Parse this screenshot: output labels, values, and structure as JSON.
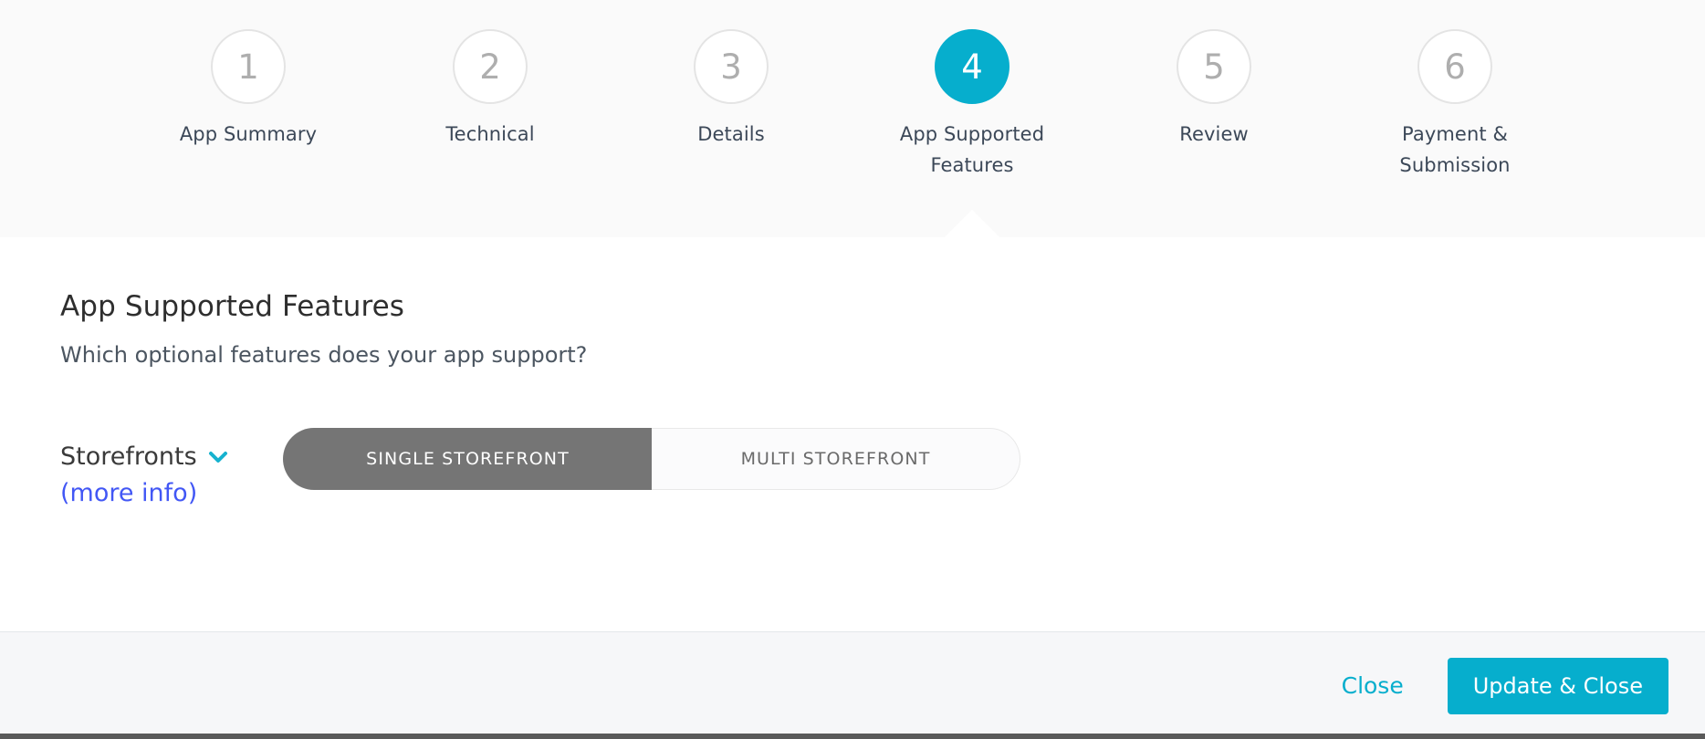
{
  "wizard": {
    "active_step": 4,
    "accent_color": "#06aecd",
    "steps": [
      {
        "number": "1",
        "label": "App Summary"
      },
      {
        "number": "2",
        "label": "Technical"
      },
      {
        "number": "3",
        "label": "Details"
      },
      {
        "number": "4",
        "label": "App Supported Features"
      },
      {
        "number": "5",
        "label": "Review"
      },
      {
        "number": "6",
        "label": "Payment & Submission"
      }
    ]
  },
  "main": {
    "title": "App Supported Features",
    "subtitle": "Which optional features does your app support?",
    "features": [
      {
        "label": "Storefronts",
        "expander_icon": "chevron-down-icon",
        "more_info_label": "(more info)",
        "options": [
          {
            "label": "SINGLE STOREFRONT",
            "selected": true
          },
          {
            "label": "MULTI STOREFRONT",
            "selected": false
          }
        ]
      }
    ]
  },
  "footer": {
    "close_label": "Close",
    "update_close_label": "Update & Close"
  }
}
